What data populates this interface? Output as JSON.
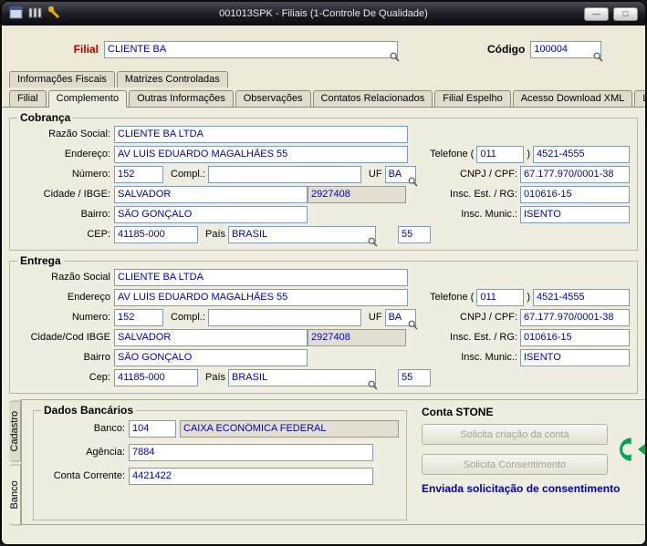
{
  "window": {
    "title": "001013SPK - Filiais (1-Controle De Qualidade)",
    "minimize_glyph": "—",
    "maximize_glyph": "□"
  },
  "header": {
    "filial_label": "Filial",
    "filial_value": "CLIENTE BA",
    "codigo_label": "Código",
    "codigo_value": "100004"
  },
  "tabs_top": [
    {
      "label": "Informações Fiscais"
    },
    {
      "label": "Matrizes Controladas"
    }
  ],
  "tabs_main": [
    {
      "label": "Filial"
    },
    {
      "label": "Complemento"
    },
    {
      "label": "Outras Informações"
    },
    {
      "label": "Observações"
    },
    {
      "label": "Contatos Relacionados"
    },
    {
      "label": "Filial Espelho"
    },
    {
      "label": "Acesso Download XML"
    },
    {
      "label": "Log"
    }
  ],
  "cobranca": {
    "title": "Cobrança",
    "labels": {
      "razao_social": "Razão Social:",
      "endereco": "Endereço:",
      "numero": "Número:",
      "compl": "Compl.:",
      "uf": "UF",
      "cidade": "Cidade / IBGE:",
      "bairro": "Bairro:",
      "cep": "CEP:",
      "pais": "País",
      "telefone": "Telefone",
      "paren_open": "(",
      "paren_close": ")",
      "cnpj": "CNPJ / CPF:",
      "insc_est": "Insc. Est. / RG:",
      "insc_munic": "Insc. Munic.:"
    },
    "values": {
      "razao_social": "CLIENTE BA LTDA",
      "endereco": "AV LUÍS EDUARDO MAGALHÃES 55",
      "numero": "152",
      "compl": "",
      "uf": "BA",
      "cidade": "SALVADOR",
      "ibge": "2927408",
      "bairro": "SÃO GONÇALO",
      "cep": "41185-000",
      "pais": "BRASIL",
      "pais_cod": "55",
      "telefone_ddd": "011",
      "telefone_num": "4521-4555",
      "cnpj": "67.177.970/0001-38",
      "insc_est": "010616-15",
      "insc_munic": "ISENTO"
    }
  },
  "entrega": {
    "title": "Entrega",
    "labels": {
      "razao_social": "Razão Social",
      "endereco": "Endereço",
      "numero": "Numero:",
      "compl": "Compl.:",
      "uf": "UF",
      "cidade": "Cidade/Cod IBGE",
      "bairro": "Bairro",
      "cep": "Cep:",
      "pais": "País",
      "telefone": "Telefone",
      "paren_open": "(",
      "paren_close": ")",
      "cnpj": "CNPJ / CPF:",
      "insc_est": "Insc. Est. / RG:",
      "insc_munic": "Insc. Munic.:"
    },
    "values": {
      "razao_social": "CLIENTE BA LTDA",
      "endereco": "AV LUÍS EDUARDO MAGALHÃES 55",
      "numero": "152",
      "compl": "",
      "uf": "BA",
      "cidade": "SALVADOR",
      "ibge": "2927408",
      "bairro": "SÃO GONÇALO",
      "cep": "41185-000",
      "pais": "BRASIL",
      "pais_cod": "55",
      "telefone_ddd": "011",
      "telefone_num": "4521-4555",
      "cnpj": "67.177.970/0001-38",
      "insc_est": "010616-15",
      "insc_munic": "ISENTO"
    }
  },
  "side_tabs": [
    {
      "label": "Cadastro"
    },
    {
      "label": "Banco"
    }
  ],
  "banco": {
    "title": "Dados Bancários",
    "banco_label": "Banco:",
    "banco_value": "104",
    "banco_nome": "CAIXA ECONÔMICA FEDERAL",
    "agencia_label": "Agência:",
    "agencia_value": "7884",
    "conta_label": "Conta Corrente:",
    "conta_value": "4421422"
  },
  "stone": {
    "title": "Conta STONE",
    "btn_criacao": "Solicita criação da conta",
    "btn_consentimento": "Solicita Consentimento",
    "status": "Enviada solicitação de consentimento"
  },
  "colors": {
    "accent_red": "#C00000",
    "input_text": "#0000C8",
    "status_blue": "#0000BB",
    "stone_green": "#00A651"
  }
}
